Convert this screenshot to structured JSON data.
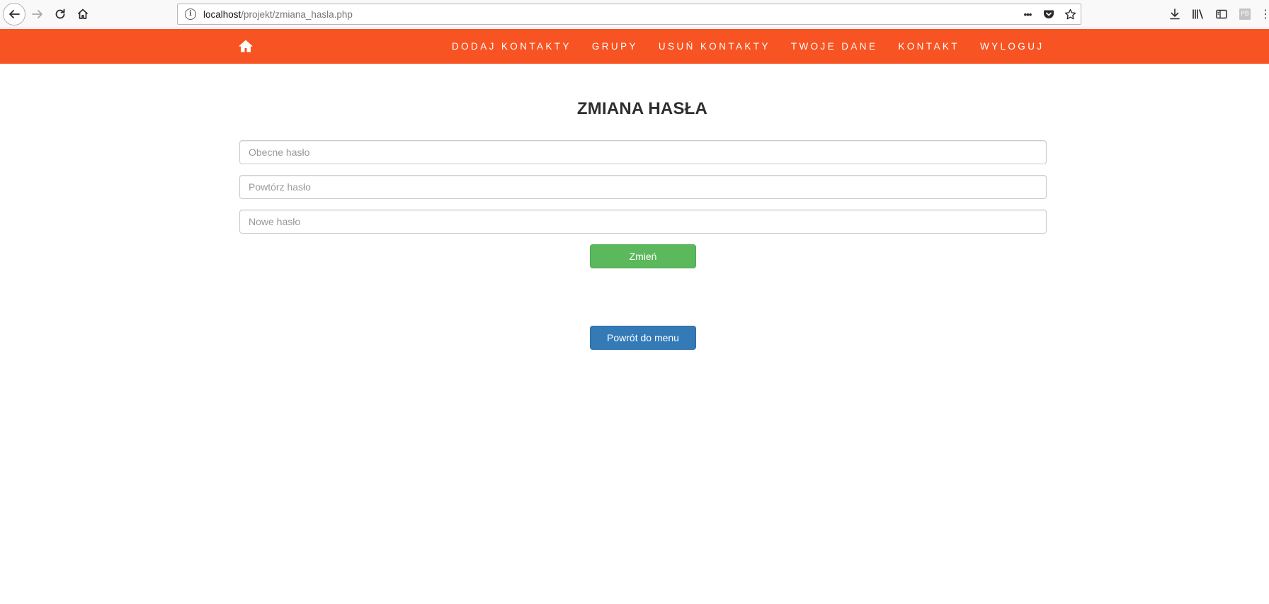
{
  "browser": {
    "url_host": "localhost",
    "url_path": "/projekt/zmiana_hasla.php",
    "page_actions_label": "•••",
    "info_icon_text": "i",
    "extension_label": "PB",
    "menu_label": "⋮",
    "icons": [
      "back-arrow-icon",
      "forward-arrow-icon",
      "reload-icon",
      "home-icon",
      "info-icon",
      "pocket-icon",
      "star-icon",
      "download-icon",
      "library-icon",
      "sidebar-icon",
      "extension-icon",
      "menu-icon"
    ]
  },
  "navbar": {
    "background": "#f85322",
    "home_icon": "home-icon",
    "links": [
      "DODAJ KONTAKTY",
      "GRUPY",
      "USUŃ KONTAKTY",
      "TWOJE DANE",
      "KONTAKT",
      "WYLOGUJ"
    ]
  },
  "main": {
    "title": "ZMIANA HASŁA",
    "fields": {
      "current_password": {
        "placeholder": "Obecne hasło",
        "value": ""
      },
      "repeat_password": {
        "placeholder": "Powtórz hasło",
        "value": ""
      },
      "new_password": {
        "placeholder": "Nowe hasło",
        "value": ""
      }
    },
    "change_button": "Zmień",
    "back_button": "Powrót do menu"
  },
  "colors": {
    "accent": "#f85322",
    "success": "#5cb85c",
    "primary": "#337ab7"
  }
}
